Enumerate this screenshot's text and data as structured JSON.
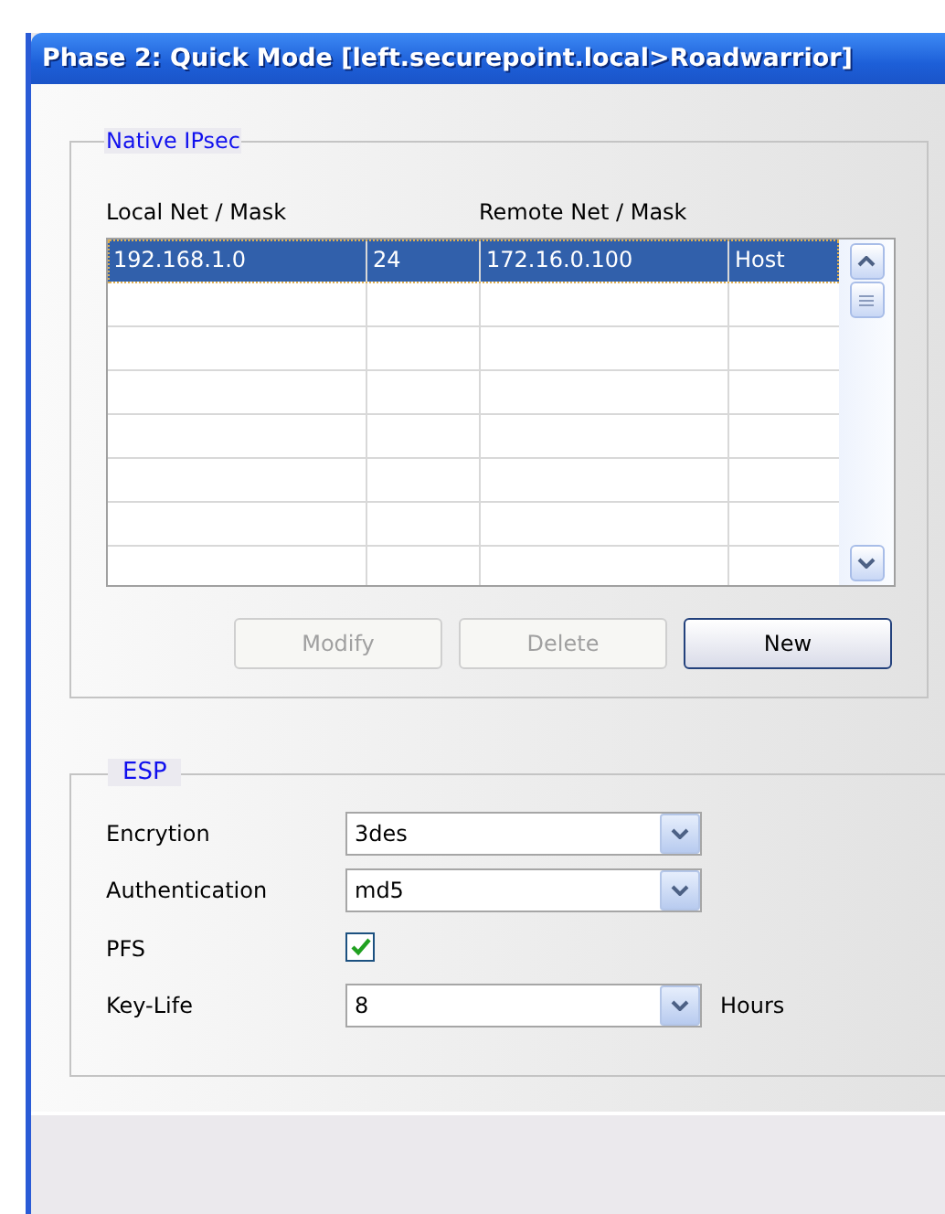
{
  "window": {
    "title": "Phase 2: Quick Mode [left.securepoint.local>Roadwarrior]"
  },
  "native_ipsec": {
    "title": "Native IPsec",
    "columns": [
      "Local Net / Mask",
      "",
      "Remote Net / Mask",
      ""
    ],
    "rows": [
      {
        "cells": [
          "192.168.1.0",
          "24",
          "172.16.0.100",
          "Host"
        ],
        "selected": true
      }
    ],
    "buttons": [
      {
        "label": "Modify",
        "disabled": true
      },
      {
        "label": "Delete",
        "disabled": true
      },
      {
        "label": "New",
        "disabled": false
      }
    ]
  },
  "esp": {
    "title": "ESP",
    "fields": [
      {
        "kind": "select",
        "label": "Encrytion",
        "value": "3des"
      },
      {
        "kind": "select",
        "label": "Authentication",
        "value": "md5"
      },
      {
        "kind": "checkbox",
        "label": "PFS",
        "checked": true
      },
      {
        "kind": "select",
        "label": "Key-Life",
        "value": "8",
        "unit": "Hours"
      }
    ]
  }
}
